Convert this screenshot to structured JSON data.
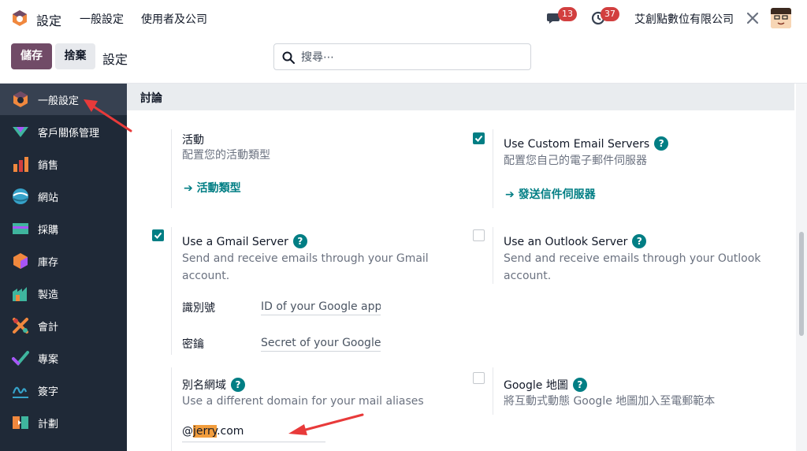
{
  "topbar": {
    "app_name": "設定",
    "menu_general": "一般設定",
    "menu_users": "使用者及公司",
    "chat_count": "13",
    "activity_count": "37",
    "company": "艾創點數位有限公司"
  },
  "controls": {
    "save_label": "儲存",
    "discard_label": "捨棄",
    "page_title": "設定",
    "search_placeholder": "搜尋⋯"
  },
  "sidebar": {
    "items": [
      {
        "label": "一般設定",
        "icon": "settings-icon",
        "color": "#f0883e"
      },
      {
        "label": "客戶關係管理",
        "icon": "crm-icon",
        "color": "#3fb59e"
      },
      {
        "label": "銷售",
        "icon": "sales-icon",
        "color": "#f0883e"
      },
      {
        "label": "網站",
        "icon": "website-icon",
        "color": "#36a2c9"
      },
      {
        "label": "採購",
        "icon": "purchase-icon",
        "color": "#3fb59e"
      },
      {
        "label": "庫存",
        "icon": "inventory-icon",
        "color": "#f0883e"
      },
      {
        "label": "製造",
        "icon": "manufacturing-icon",
        "color": "#3fb59e"
      },
      {
        "label": "會計",
        "icon": "accounting-icon",
        "color": "#f0883e"
      },
      {
        "label": "專案",
        "icon": "project-icon",
        "color": "#3fb59e"
      },
      {
        "label": "簽字",
        "icon": "sign-icon",
        "color": "#36a2c9"
      },
      {
        "label": "計劃",
        "icon": "planning-icon",
        "color": "#f0883e"
      }
    ]
  },
  "section": {
    "title": "討論",
    "activities": {
      "title": "活動",
      "desc": "配置您的活動類型",
      "link": "活動類型"
    },
    "custom_email": {
      "title": "Use Custom Email Servers",
      "desc": "配置您自己的電子郵件伺服器",
      "link": "發送信件伺服器",
      "checked": true
    },
    "gmail": {
      "title": "Use a Gmail Server",
      "desc_line1": "Send and receive emails through your Gmail",
      "desc_line2": "account.",
      "checked": true,
      "id_label": "識別號",
      "id_placeholder": "ID of your Google app",
      "key_label": "密鑰",
      "key_placeholder": "Secret of your Google a"
    },
    "outlook": {
      "title": "Use an Outlook Server",
      "desc_line1": "Send and receive emails through your Outlook",
      "desc_line2": "account.",
      "checked": false
    },
    "alias": {
      "title": "別名網域",
      "desc": "Use a different domain for your mail aliases",
      "prefix": "@",
      "highlight": "jerry",
      "suffix": ".com"
    },
    "google_maps": {
      "title": "Google 地圖",
      "desc": "將互動式動態 Google 地圖加入至電郵範本",
      "checked": false
    }
  },
  "colors": {
    "brand": "#714b67",
    "accent": "#017e84",
    "badge": "#d23f3f",
    "annotation": "#e83a3a"
  }
}
